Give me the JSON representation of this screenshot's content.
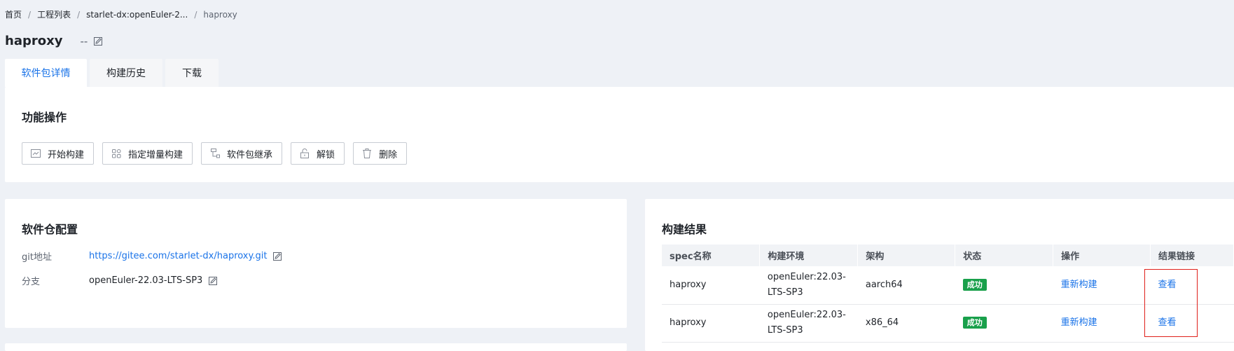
{
  "breadcrumb": {
    "items": [
      "首页",
      "工程列表",
      "starlet-dx:openEuler-2...",
      "haproxy"
    ],
    "separator": "/"
  },
  "page": {
    "title": "haproxy",
    "description": "--"
  },
  "tabs": [
    {
      "label": "软件包详情",
      "active": true
    },
    {
      "label": "构建历史",
      "active": false
    },
    {
      "label": "下载",
      "active": false
    }
  ],
  "functions": {
    "title": "功能操作",
    "buttons": [
      {
        "label": "开始构建",
        "icon": "build-icon"
      },
      {
        "label": "指定增量构建",
        "icon": "grid-icon"
      },
      {
        "label": "软件包继承",
        "icon": "inherit-icon"
      },
      {
        "label": "解锁",
        "icon": "unlock-icon"
      },
      {
        "label": "删除",
        "icon": "trash-icon"
      }
    ]
  },
  "repo": {
    "title": "软件仓配置",
    "git_label": "git地址",
    "git_value": "https://gitee.com/starlet-dx/haproxy.git",
    "branch_label": "分支",
    "branch_value": "openEuler-22.03-LTS-SP3"
  },
  "results": {
    "title": "构建结果",
    "columns": [
      "spec名称",
      "构建环境",
      "架构",
      "状态",
      "操作",
      "结果链接"
    ],
    "rows": [
      {
        "spec": "haproxy",
        "env_line1": "openEuler:22.03-",
        "env_line2": "LTS-SP3",
        "arch": "aarch64",
        "status": "成功",
        "action": "重新构建",
        "link": "查看"
      },
      {
        "spec": "haproxy",
        "env_line1": "openEuler:22.03-",
        "env_line2": "LTS-SP3",
        "arch": "x86_64",
        "status": "成功",
        "action": "重新构建",
        "link": "查看"
      }
    ]
  },
  "colors": {
    "accent": "#1a73e8",
    "success": "#19a04b",
    "highlight": "#e0201b",
    "background": "#eef1f6"
  }
}
